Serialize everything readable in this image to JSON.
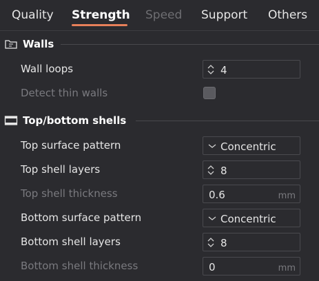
{
  "tabs": [
    {
      "label": "Quality",
      "state": "normal"
    },
    {
      "label": "Strength",
      "state": "active"
    },
    {
      "label": "Speed",
      "state": "disabled"
    },
    {
      "label": "Support",
      "state": "normal"
    },
    {
      "label": "Others",
      "state": "normal"
    }
  ],
  "colors": {
    "accent": "#e8805a",
    "background": "#2b2b2f",
    "dim_text": "#7a7a7f"
  },
  "walls": {
    "title": "Walls",
    "icon": "walls-icon",
    "wall_loops": {
      "label": "Wall loops",
      "value": "4"
    },
    "detect_thin_walls": {
      "label": "Detect thin walls",
      "checked": false
    }
  },
  "shells": {
    "title": "Top/bottom shells",
    "icon": "shells-icon",
    "top_surface_pattern": {
      "label": "Top surface pattern",
      "value": "Concentric"
    },
    "top_shell_layers": {
      "label": "Top shell layers",
      "value": "8"
    },
    "top_shell_thickness": {
      "label": "Top shell thickness",
      "value": "0.6",
      "unit": "mm"
    },
    "bottom_surface_pattern": {
      "label": "Bottom surface pattern",
      "value": "Concentric"
    },
    "bottom_shell_layers": {
      "label": "Bottom shell layers",
      "value": "8"
    },
    "bottom_shell_thickness": {
      "label": "Bottom shell thickness",
      "value": "0",
      "unit": "mm"
    }
  }
}
